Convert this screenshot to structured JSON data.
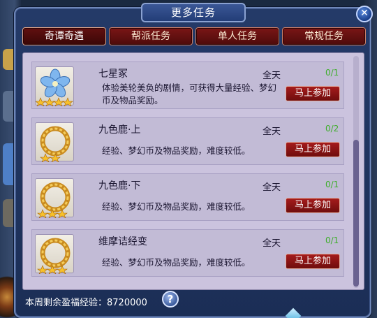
{
  "window": {
    "title": "更多任务"
  },
  "tabs": [
    {
      "label": "奇谭奇遇",
      "active": true
    },
    {
      "label": "帮派任务",
      "active": false
    },
    {
      "label": "单人任务",
      "active": false
    },
    {
      "label": "常规任务",
      "active": false
    }
  ],
  "tasks": [
    {
      "name": "七星冢",
      "time": "全天",
      "count": "0/1",
      "desc": "体验美轮美奂的剧情，可获得大量经验、梦幻币及物品奖励。",
      "join": "马上参加",
      "icon": "blue-flower-icon",
      "stars": 4
    },
    {
      "name": "九色鹿·上",
      "time": "全天",
      "count": "0/2",
      "desc": "经验、梦幻币及物品奖励，难度较低。",
      "join": "马上参加",
      "icon": "golden-ring-icon",
      "stars": 2
    },
    {
      "name": "九色鹿·下",
      "time": "全天",
      "count": "0/1",
      "desc": "经验、梦幻币及物品奖励，难度较低。",
      "join": "马上参加",
      "icon": "golden-ring-icon",
      "stars": 3
    },
    {
      "name": "维摩诘经变",
      "time": "全天",
      "count": "0/1",
      "desc": "经验、梦幻币及物品奖励，难度较低。",
      "join": "马上参加",
      "icon": "golden-ring-icon",
      "stars": 3
    }
  ],
  "footer": {
    "label": "本周剩余盈福经验：",
    "value": "8720000",
    "help": "?"
  },
  "colors": {
    "tab_bg": "#6a1212",
    "join_bg": "#8d1515",
    "count_green": "#3fae2c",
    "panel_bg": "#cbc3de"
  }
}
